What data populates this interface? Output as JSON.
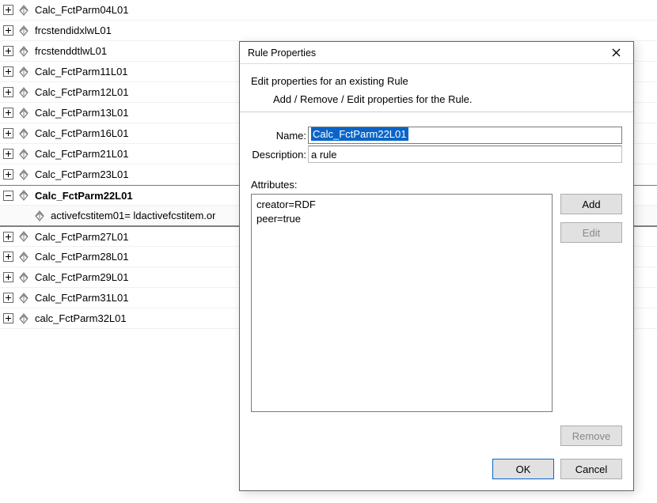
{
  "tree": {
    "rows": [
      {
        "expand": "plus",
        "label": "Calc_FctParm04L01",
        "bold": false
      },
      {
        "expand": "plus",
        "label": "frcstendidxlwL01",
        "bold": false
      },
      {
        "expand": "plus",
        "label": "frcstenddtlwL01",
        "bold": false
      },
      {
        "expand": "plus",
        "label": "Calc_FctParm11L01",
        "bold": false
      },
      {
        "expand": "plus",
        "label": "Calc_FctParm12L01",
        "bold": false
      },
      {
        "expand": "plus",
        "label": "Calc_FctParm13L01",
        "bold": false
      },
      {
        "expand": "plus",
        "label": "Calc_FctParm16L01",
        "bold": false
      },
      {
        "expand": "plus",
        "label": "Calc_FctParm21L01",
        "bold": false
      },
      {
        "expand": "plus",
        "label": "Calc_FctParm23L01",
        "bold": false
      },
      {
        "expand": "minus",
        "label": "Calc_FctParm22L01",
        "bold": true
      },
      {
        "expand": "none",
        "label": "activefcstitem01= ldactivefcstitem.or",
        "bold": false,
        "child": true
      },
      {
        "expand": "plus",
        "label": "Calc_FctParm27L01",
        "bold": false
      },
      {
        "expand": "plus",
        "label": "Calc_FctParm28L01",
        "bold": false
      },
      {
        "expand": "plus",
        "label": "Calc_FctParm29L01",
        "bold": false
      },
      {
        "expand": "plus",
        "label": "Calc_FctParm31L01",
        "bold": false
      },
      {
        "expand": "plus",
        "label": "calc_FctParm32L01",
        "bold": false
      }
    ]
  },
  "dialog": {
    "title": "Rule Properties",
    "header_main": "Edit properties for an existing Rule",
    "header_sub": "Add / Remove / Edit properties for the Rule.",
    "name_label": "Name:",
    "name_value": "Calc_FctParm22L01",
    "desc_label": "Description:",
    "desc_value": "a rule",
    "attr_label": "Attributes:",
    "attr_lines": [
      "creator=RDF",
      "peer=true"
    ],
    "buttons": {
      "add": "Add",
      "edit": "Edit",
      "remove": "Remove",
      "ok": "OK",
      "cancel": "Cancel"
    }
  }
}
